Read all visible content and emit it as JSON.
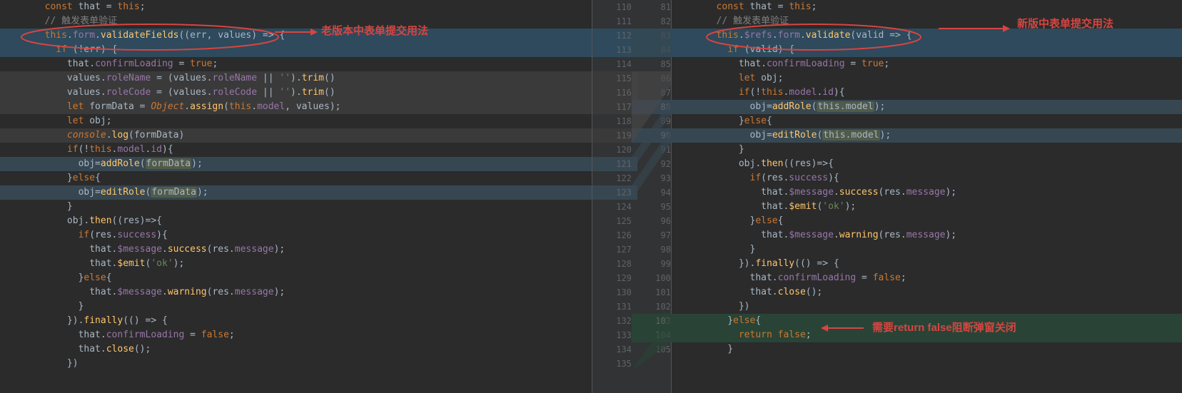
{
  "annotations": {
    "old_usage": "老版本中表单提交用法",
    "new_usage": "新版中表单提交用法",
    "return_false": "需要return false阻断弹窗关闭"
  },
  "left_gutter_numbers": [
    "110",
    "111",
    "112",
    "113",
    "114",
    "115",
    "116",
    "117",
    "118",
    "119",
    "120",
    "121",
    "122",
    "123",
    "124",
    "125",
    "126",
    "127",
    "128",
    "129",
    "130",
    "131",
    "132",
    "133",
    "134",
    "135"
  ],
  "right_gutter_numbers": [
    "81",
    "82",
    "83",
    "84",
    "85",
    "86",
    "87",
    "88",
    "89",
    "90",
    "91",
    "92",
    "93",
    "94",
    "95",
    "96",
    "97",
    "98",
    "99",
    "100",
    "101",
    "102",
    "103",
    "104",
    "105",
    ""
  ],
  "left_code": [
    {
      "bg": "none",
      "indent": 8,
      "tokens": [
        [
          "kw",
          "const"
        ],
        [
          "ident",
          " that = "
        ],
        [
          "kw",
          "this"
        ],
        [
          "ident",
          ";"
        ]
      ]
    },
    {
      "bg": "none",
      "indent": 8,
      "tokens": [
        [
          "cmt",
          "// 触发表单验证"
        ]
      ]
    },
    {
      "bg": "modline",
      "indent": 8,
      "tokens": [
        [
          "kw",
          "this"
        ],
        [
          "ident",
          "."
        ],
        [
          "prop",
          "form"
        ],
        [
          "ident",
          "."
        ],
        [
          "fn",
          "validateFields"
        ],
        [
          "ident",
          "(("
        ],
        [
          "ident",
          "err"
        ],
        [
          "ident",
          ", "
        ],
        [
          "ident",
          "values"
        ],
        [
          "ident",
          ") => {"
        ]
      ]
    },
    {
      "bg": "modline",
      "indent": 10,
      "tokens": [
        [
          "kw",
          "if"
        ],
        [
          "ident",
          " (!"
        ],
        [
          "ident",
          "err"
        ],
        [
          "ident",
          ") {"
        ]
      ]
    },
    {
      "bg": "none",
      "indent": 12,
      "tokens": [
        [
          "ident",
          "that."
        ],
        [
          "prop",
          "confirmLoading"
        ],
        [
          "ident",
          " = "
        ],
        [
          "kw",
          "true"
        ],
        [
          "ident",
          ";"
        ]
      ]
    },
    {
      "bg": "gray",
      "indent": 12,
      "tokens": [
        [
          "ident",
          "values."
        ],
        [
          "prop",
          "roleName"
        ],
        [
          "ident",
          " = (values."
        ],
        [
          "prop",
          "roleName"
        ],
        [
          "ident",
          " || "
        ],
        [
          "str",
          "''"
        ],
        [
          "ident",
          ")."
        ],
        [
          "fn",
          "trim"
        ],
        [
          "ident",
          "()"
        ]
      ]
    },
    {
      "bg": "gray",
      "indent": 12,
      "tokens": [
        [
          "ident",
          "values."
        ],
        [
          "prop",
          "roleCode"
        ],
        [
          "ident",
          " = (values."
        ],
        [
          "prop",
          "roleCode"
        ],
        [
          "ident",
          " || "
        ],
        [
          "str",
          "''"
        ],
        [
          "ident",
          ")."
        ],
        [
          "fn",
          "trim"
        ],
        [
          "ident",
          "()"
        ]
      ]
    },
    {
      "bg": "gray",
      "indent": 12,
      "tokens": [
        [
          "kw",
          "let"
        ],
        [
          "ident",
          " formData = "
        ],
        [
          "builtin",
          "Object"
        ],
        [
          "ident",
          "."
        ],
        [
          "fn",
          "assign"
        ],
        [
          "ident",
          "("
        ],
        [
          "kw",
          "this"
        ],
        [
          "ident",
          "."
        ],
        [
          "prop",
          "model"
        ],
        [
          "ident",
          ", values);"
        ]
      ]
    },
    {
      "bg": "none",
      "indent": 12,
      "tokens": [
        [
          "kw",
          "let"
        ],
        [
          "ident",
          " obj;"
        ]
      ]
    },
    {
      "bg": "gray",
      "indent": 12,
      "tokens": [
        [
          "builtin",
          "console"
        ],
        [
          "ident",
          "."
        ],
        [
          "fn",
          "log"
        ],
        [
          "ident",
          "(formData)"
        ]
      ]
    },
    {
      "bg": "none",
      "indent": 12,
      "tokens": [
        [
          "kw",
          "if"
        ],
        [
          "ident",
          "(!"
        ],
        [
          "kw",
          "this"
        ],
        [
          "ident",
          "."
        ],
        [
          "prop",
          "model"
        ],
        [
          "ident",
          "."
        ],
        [
          "prop",
          "id"
        ],
        [
          "ident",
          "){"
        ]
      ]
    },
    {
      "bg": "mod",
      "indent": 14,
      "tokens": [
        [
          "ident",
          "obj="
        ],
        [
          "fn",
          "addRole"
        ],
        [
          "ident",
          "("
        ],
        [
          "hlword",
          "formData"
        ],
        [
          "ident",
          ");"
        ]
      ]
    },
    {
      "bg": "none",
      "indent": 12,
      "tokens": [
        [
          "ident",
          "}"
        ],
        [
          "kw",
          "else"
        ],
        [
          "ident",
          "{"
        ]
      ]
    },
    {
      "bg": "mod",
      "indent": 14,
      "tokens": [
        [
          "ident",
          "obj="
        ],
        [
          "fn",
          "editRole"
        ],
        [
          "ident",
          "("
        ],
        [
          "hlword",
          "formData"
        ],
        [
          "ident",
          ");"
        ]
      ]
    },
    {
      "bg": "none",
      "indent": 12,
      "tokens": [
        [
          "ident",
          "}"
        ]
      ]
    },
    {
      "bg": "none",
      "indent": 12,
      "tokens": [
        [
          "ident",
          "obj."
        ],
        [
          "fn",
          "then"
        ],
        [
          "ident",
          "((res)=>{"
        ]
      ]
    },
    {
      "bg": "none",
      "indent": 14,
      "tokens": [
        [
          "kw",
          "if"
        ],
        [
          "ident",
          "(res."
        ],
        [
          "prop",
          "success"
        ],
        [
          "ident",
          "){"
        ]
      ]
    },
    {
      "bg": "none",
      "indent": 16,
      "tokens": [
        [
          "ident",
          "that."
        ],
        [
          "prop",
          "$message"
        ],
        [
          "ident",
          "."
        ],
        [
          "fn",
          "success"
        ],
        [
          "ident",
          "(res."
        ],
        [
          "prop",
          "message"
        ],
        [
          "ident",
          ");"
        ]
      ]
    },
    {
      "bg": "none",
      "indent": 16,
      "tokens": [
        [
          "ident",
          "that."
        ],
        [
          "fn",
          "$emit"
        ],
        [
          "ident",
          "("
        ],
        [
          "str",
          "'ok'"
        ],
        [
          "ident",
          ");"
        ]
      ]
    },
    {
      "bg": "none",
      "indent": 14,
      "tokens": [
        [
          "ident",
          "}"
        ],
        [
          "kw",
          "else"
        ],
        [
          "ident",
          "{"
        ]
      ]
    },
    {
      "bg": "none",
      "indent": 16,
      "tokens": [
        [
          "ident",
          "that."
        ],
        [
          "prop",
          "$message"
        ],
        [
          "ident",
          "."
        ],
        [
          "fn",
          "warning"
        ],
        [
          "ident",
          "(res."
        ],
        [
          "prop",
          "message"
        ],
        [
          "ident",
          ");"
        ]
      ]
    },
    {
      "bg": "none",
      "indent": 14,
      "tokens": [
        [
          "ident",
          "}"
        ]
      ]
    },
    {
      "bg": "none",
      "indent": 12,
      "tokens": [
        [
          "ident",
          "})."
        ],
        [
          "fn",
          "finally"
        ],
        [
          "ident",
          "(() => {"
        ]
      ]
    },
    {
      "bg": "none",
      "indent": 14,
      "tokens": [
        [
          "ident",
          "that."
        ],
        [
          "prop",
          "confirmLoading"
        ],
        [
          "ident",
          " = "
        ],
        [
          "kw",
          "false"
        ],
        [
          "ident",
          ";"
        ]
      ]
    },
    {
      "bg": "none",
      "indent": 14,
      "tokens": [
        [
          "ident",
          "that."
        ],
        [
          "fn",
          "close"
        ],
        [
          "ident",
          "();"
        ]
      ]
    },
    {
      "bg": "none",
      "indent": 12,
      "tokens": [
        [
          "ident",
          "})"
        ]
      ]
    }
  ],
  "right_code": [
    {
      "bg": "none",
      "indent": 8,
      "tokens": [
        [
          "kw",
          "const"
        ],
        [
          "ident",
          " that = "
        ],
        [
          "kw",
          "this"
        ],
        [
          "ident",
          ";"
        ]
      ]
    },
    {
      "bg": "none",
      "indent": 8,
      "tokens": [
        [
          "cmt",
          "// 触发表单验证"
        ]
      ]
    },
    {
      "bg": "modline",
      "indent": 8,
      "tokens": [
        [
          "kw",
          "this"
        ],
        [
          "ident",
          "."
        ],
        [
          "prop",
          "$refs"
        ],
        [
          "ident",
          "."
        ],
        [
          "prop",
          "form"
        ],
        [
          "ident",
          "."
        ],
        [
          "fn",
          "validate"
        ],
        [
          "ident",
          "("
        ],
        [
          "ident",
          "valid"
        ],
        [
          "ident",
          " => {"
        ]
      ]
    },
    {
      "bg": "modline",
      "indent": 10,
      "tokens": [
        [
          "kw",
          "if"
        ],
        [
          "ident",
          " ("
        ],
        [
          "ident",
          "valid"
        ],
        [
          "ident",
          ") {"
        ]
      ]
    },
    {
      "bg": "none",
      "indent": 12,
      "tokens": [
        [
          "ident",
          "that."
        ],
        [
          "prop",
          "confirmLoading"
        ],
        [
          "ident",
          " = "
        ],
        [
          "kw",
          "true"
        ],
        [
          "ident",
          ";"
        ]
      ]
    },
    {
      "bg": "none",
      "indent": 12,
      "tokens": [
        [
          "kw",
          "let"
        ],
        [
          "ident",
          " obj;"
        ]
      ]
    },
    {
      "bg": "none",
      "indent": 12,
      "tokens": [
        [
          "kw",
          "if"
        ],
        [
          "ident",
          "(!"
        ],
        [
          "kw",
          "this"
        ],
        [
          "ident",
          "."
        ],
        [
          "prop",
          "model"
        ],
        [
          "ident",
          "."
        ],
        [
          "prop",
          "id"
        ],
        [
          "ident",
          "){"
        ]
      ]
    },
    {
      "bg": "mod",
      "indent": 14,
      "tokens": [
        [
          "ident",
          "obj="
        ],
        [
          "fn",
          "addRole"
        ],
        [
          "ident",
          "("
        ],
        [
          "hlword",
          "this.model"
        ],
        [
          "ident",
          ");"
        ]
      ]
    },
    {
      "bg": "none",
      "indent": 12,
      "tokens": [
        [
          "ident",
          "}"
        ],
        [
          "kw",
          "else"
        ],
        [
          "ident",
          "{"
        ]
      ]
    },
    {
      "bg": "mod",
      "indent": 14,
      "tokens": [
        [
          "ident",
          "obj="
        ],
        [
          "fn",
          "editRole"
        ],
        [
          "ident",
          "("
        ],
        [
          "hlword",
          "this.model"
        ],
        [
          "ident",
          ");"
        ]
      ]
    },
    {
      "bg": "none",
      "indent": 12,
      "tokens": [
        [
          "ident",
          "}"
        ]
      ]
    },
    {
      "bg": "none",
      "indent": 12,
      "tokens": [
        [
          "ident",
          "obj."
        ],
        [
          "fn",
          "then"
        ],
        [
          "ident",
          "((res)=>{"
        ]
      ]
    },
    {
      "bg": "none",
      "indent": 14,
      "tokens": [
        [
          "kw",
          "if"
        ],
        [
          "ident",
          "(res."
        ],
        [
          "prop",
          "success"
        ],
        [
          "ident",
          "){"
        ]
      ]
    },
    {
      "bg": "none",
      "indent": 16,
      "tokens": [
        [
          "ident",
          "that."
        ],
        [
          "prop",
          "$message"
        ],
        [
          "ident",
          "."
        ],
        [
          "fn",
          "success"
        ],
        [
          "ident",
          "(res."
        ],
        [
          "prop",
          "message"
        ],
        [
          "ident",
          ");"
        ]
      ]
    },
    {
      "bg": "none",
      "indent": 16,
      "tokens": [
        [
          "ident",
          "that."
        ],
        [
          "fn",
          "$emit"
        ],
        [
          "ident",
          "("
        ],
        [
          "str",
          "'ok'"
        ],
        [
          "ident",
          ");"
        ]
      ]
    },
    {
      "bg": "none",
      "indent": 14,
      "tokens": [
        [
          "ident",
          "}"
        ],
        [
          "kw",
          "else"
        ],
        [
          "ident",
          "{"
        ]
      ]
    },
    {
      "bg": "none",
      "indent": 16,
      "tokens": [
        [
          "ident",
          "that."
        ],
        [
          "prop",
          "$message"
        ],
        [
          "ident",
          "."
        ],
        [
          "fn",
          "warning"
        ],
        [
          "ident",
          "(res."
        ],
        [
          "prop",
          "message"
        ],
        [
          "ident",
          ");"
        ]
      ]
    },
    {
      "bg": "none",
      "indent": 14,
      "tokens": [
        [
          "ident",
          "}"
        ]
      ]
    },
    {
      "bg": "none",
      "indent": 12,
      "tokens": [
        [
          "ident",
          "})."
        ],
        [
          "fn",
          "finally"
        ],
        [
          "ident",
          "(() => {"
        ]
      ]
    },
    {
      "bg": "none",
      "indent": 14,
      "tokens": [
        [
          "ident",
          "that."
        ],
        [
          "prop",
          "confirmLoading"
        ],
        [
          "ident",
          " = "
        ],
        [
          "kw",
          "false"
        ],
        [
          "ident",
          ";"
        ]
      ]
    },
    {
      "bg": "none",
      "indent": 14,
      "tokens": [
        [
          "ident",
          "that."
        ],
        [
          "fn",
          "close"
        ],
        [
          "ident",
          "();"
        ]
      ]
    },
    {
      "bg": "none",
      "indent": 12,
      "tokens": [
        [
          "ident",
          "})"
        ]
      ]
    },
    {
      "bg": "add",
      "indent": 10,
      "tokens": [
        [
          "ident",
          "}"
        ],
        [
          "kw",
          "else"
        ],
        [
          "ident",
          "{"
        ]
      ]
    },
    {
      "bg": "add",
      "indent": 12,
      "tokens": [
        [
          "kw",
          "return false"
        ],
        [
          "ident",
          ";"
        ]
      ]
    },
    {
      "bg": "none",
      "indent": 10,
      "tokens": [
        [
          "ident",
          "}"
        ]
      ]
    },
    {
      "bg": "none",
      "indent": 0,
      "tokens": [
        [
          "ident",
          ""
        ]
      ]
    }
  ]
}
